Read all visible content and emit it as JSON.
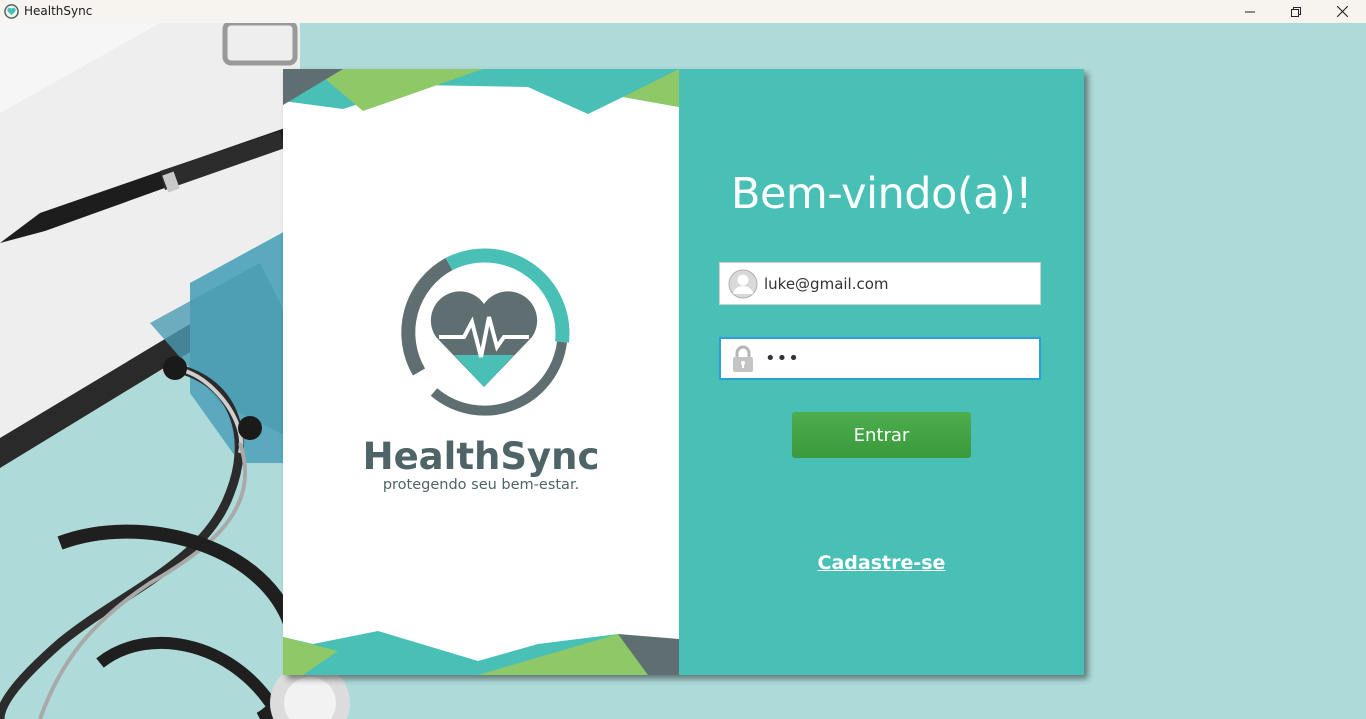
{
  "window": {
    "title": "HealthSync",
    "controls": {
      "minimize": "—",
      "maximize": "❐",
      "close": "✕"
    }
  },
  "brand": {
    "name": "HealthSync",
    "tagline": "protegendo seu bem-estar.",
    "colors": {
      "teal": "#48c0b6",
      "green": "#8fc866",
      "slate": "#5f6e70",
      "text": "#4e6466"
    }
  },
  "login": {
    "title": "Bem-vindo(a)!",
    "email": {
      "value": "luke@gmail.com",
      "icon": "user-avatar-icon"
    },
    "password": {
      "value": "•••",
      "icon": "lock-icon"
    },
    "submit_label": "Entrar",
    "signup_label": "Cadastre-se"
  }
}
